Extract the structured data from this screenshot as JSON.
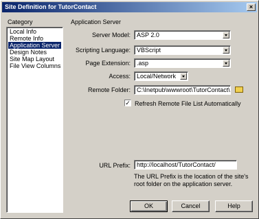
{
  "window": {
    "title": "Site Definition for TutorContact",
    "close_glyph": "×"
  },
  "category": {
    "header": "Category",
    "items": [
      "Local Info",
      "Remote Info",
      "Application Server",
      "Design Notes",
      "Site Map Layout",
      "File View Columns"
    ],
    "selected_index": 2
  },
  "section": {
    "title": "Application Server"
  },
  "form": {
    "server_model": {
      "label": "Server Model:",
      "value": "ASP  2.0"
    },
    "scripting_language": {
      "label": "Scripting Language:",
      "value": "VBScript"
    },
    "page_extension": {
      "label": "Page Extension:",
      "value": ".asp"
    },
    "access": {
      "label": "Access:",
      "value": "Local/Network"
    },
    "remote_folder": {
      "label": "Remote Folder:",
      "value": "C:\\Inetpub\\wwwroot\\TutorContact\\"
    },
    "refresh": {
      "label": "Refresh Remote File List Automatically",
      "checked": true,
      "check_glyph": "✓"
    },
    "url_prefix": {
      "label": "URL Prefix:",
      "value": "http://localhost/TutorContact/"
    },
    "note_line1": "The URL Prefix is the location of the site's",
    "note_line2": "root folder on the application server."
  },
  "buttons": {
    "ok": "OK",
    "cancel": "Cancel",
    "help": "Help"
  },
  "colors": {
    "selection": "#0a246a",
    "face": "#d4d0c8"
  }
}
